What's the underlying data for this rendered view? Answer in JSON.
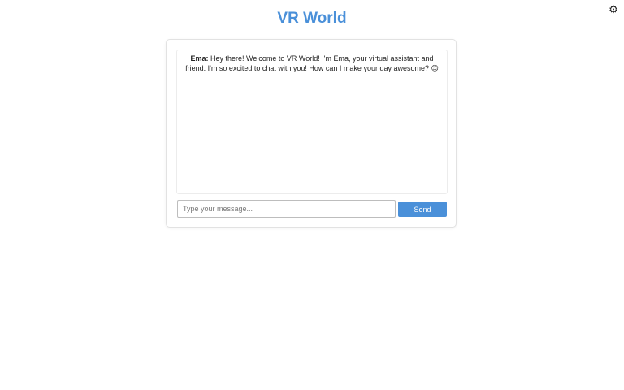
{
  "header": {
    "title": "VR World",
    "settings_icon": "⚙"
  },
  "chat": {
    "messages": [
      {
        "sender": "Ema:",
        "text_before": " Hey there! ",
        "glyph": "",
        "text_after": " Welcome to VR World! I'm Ema, your virtual assistant and friend. I'm so excited to chat with you! How can I make your day awesome? ",
        "emoji": "😊"
      }
    ]
  },
  "composer": {
    "placeholder": "Type your message...",
    "value": "",
    "send_label": "Send"
  },
  "colors": {
    "accent": "#4a90d9"
  }
}
